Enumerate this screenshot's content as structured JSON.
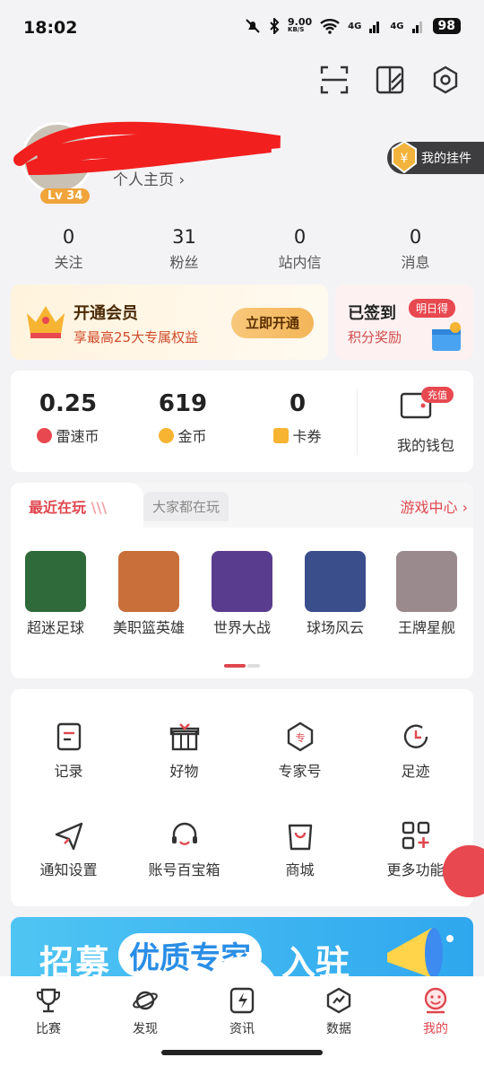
{
  "status": {
    "time": "18:02",
    "speed": "9.00",
    "speed_unit": "KB/S",
    "net1": "4G",
    "net2": "4G",
    "battery": "98"
  },
  "profile": {
    "homepage": "个人主页 ›",
    "level": "Lv 34",
    "pendant": "我的挂件"
  },
  "stats": [
    {
      "num": "0",
      "label": "关注"
    },
    {
      "num": "31",
      "label": "粉丝"
    },
    {
      "num": "0",
      "label": "站内信"
    },
    {
      "num": "0",
      "label": "消息"
    }
  ],
  "vip": {
    "title": "开通会员",
    "subtitle": "享最高25大专属权益",
    "button": "立即开通"
  },
  "signin": {
    "title": "已签到",
    "tag": "明日得",
    "subtitle": "积分奖励"
  },
  "wallet": {
    "items": [
      {
        "num": "0.25",
        "label": "雷速币"
      },
      {
        "num": "619",
        "label": "金币"
      },
      {
        "num": "0",
        "label": "卡券"
      }
    ],
    "wallet_label": "我的钱包",
    "recharge_tag": "充值"
  },
  "games": {
    "tab_recent": "最近在玩",
    "tab_others": "大家都在玩",
    "center": "游戏中心 ›",
    "list": [
      {
        "name": "超迷足球",
        "color": "#2f6a3a"
      },
      {
        "name": "美职篮英雄",
        "color": "#c96f3a"
      },
      {
        "name": "世界大战",
        "color": "#5a3c8e"
      },
      {
        "name": "球场风云",
        "color": "#3b4e8c"
      },
      {
        "name": "王牌星舰",
        "color": "#9a8a8e"
      }
    ]
  },
  "functions": [
    {
      "label": "记录",
      "icon": "record-icon"
    },
    {
      "label": "好物",
      "icon": "gift-icon"
    },
    {
      "label": "专家号",
      "icon": "expert-icon"
    },
    {
      "label": "足迹",
      "icon": "history-icon"
    },
    {
      "label": "通知设置",
      "icon": "send-icon"
    },
    {
      "label": "账号百宝箱",
      "icon": "headset-icon"
    },
    {
      "label": "商城",
      "icon": "bag-icon"
    },
    {
      "label": "更多功能",
      "icon": "grid-plus-icon"
    }
  ],
  "banner": {
    "part1": "招募",
    "part2": "优质专家",
    "part3": "入驻"
  },
  "nav": [
    {
      "label": "比赛",
      "icon": "trophy-icon"
    },
    {
      "label": "发现",
      "icon": "planet-icon"
    },
    {
      "label": "资讯",
      "icon": "lightning-icon"
    },
    {
      "label": "数据",
      "icon": "chart-icon"
    },
    {
      "label": "我的",
      "icon": "profile-icon",
      "active": true
    }
  ],
  "colors": {
    "accent": "#e0474f",
    "gold": "#f0a43a"
  }
}
